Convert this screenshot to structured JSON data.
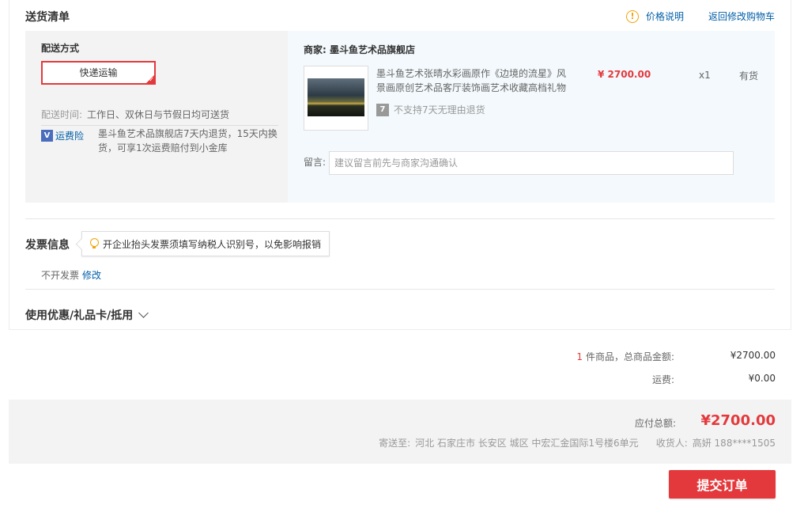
{
  "delivery": {
    "section_title": "送货清单",
    "price_help": "价格说明",
    "back_to_cart": "返回修改购物车",
    "shipping_label": "配送方式",
    "shipping_method": "快递运输",
    "time_label": "配送时间:",
    "time_value": "工作日、双休日与节假日均可送货",
    "insurance_label": "运费险",
    "insurance_desc": "墨斗鱼艺术品旗舰店7天内退货，15天内换货，可享1次运费赔付到小金库",
    "shop_label": "商家:",
    "shop_name": "墨斗鱼艺术品旗舰店",
    "item": {
      "title": "墨斗鱼艺术张晴水彩画原作《边境的流星》风景画原创艺术品客厅装饰画艺术收藏高档礼物",
      "return_policy": "不支持7天无理由退货",
      "price": "¥ 2700.00",
      "quantity": "x1",
      "stock": "有货"
    },
    "remark_label": "留言:",
    "remark_placeholder": "建议留言前先与商家沟通确认"
  },
  "invoice": {
    "title": "发票信息",
    "tip": "开企业抬头发票须填写纳税人识别号，以免影响报销",
    "value": "不开发票",
    "edit": "修改"
  },
  "coupon": {
    "title": "使用优惠/礼品卡/抵用"
  },
  "summary": {
    "count": "1",
    "count_label": "件商品，总商品金额:",
    "goods_total": "¥2700.00",
    "freight_label": "运费:",
    "freight": "¥0.00",
    "payable_label": "应付总额:",
    "payable": "¥2700.00",
    "ship_to_label": "寄送至:",
    "address": "河北 石家庄市 长安区 城区 中宏汇金国际1号楼6单元",
    "receiver_label": "收货人:",
    "receiver": "高妍 188****1505"
  },
  "submit_label": "提交订单"
}
